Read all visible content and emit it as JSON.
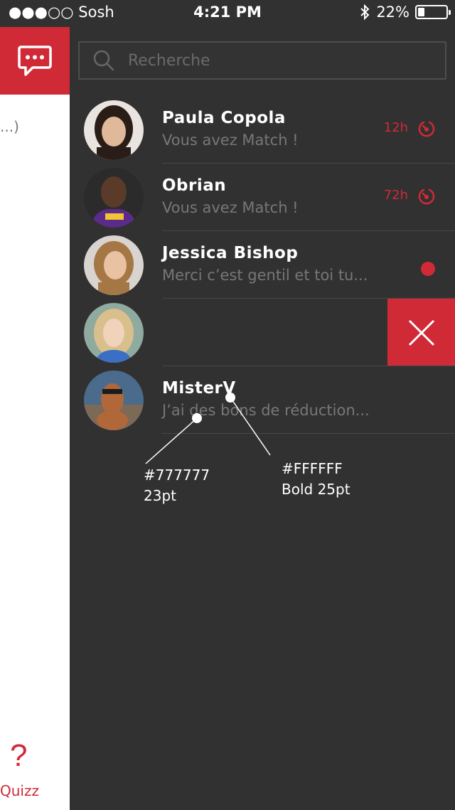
{
  "status_bar": {
    "carrier": "●●●○○ Sosh",
    "time": "4:21 PM",
    "battery": "22%"
  },
  "left_panel": {
    "snippet": "...)",
    "quizz_icon": "?",
    "quizz_label": "Quizz"
  },
  "search": {
    "placeholder": "Recherche",
    "value": ""
  },
  "conversations": [
    {
      "name": "Paula Copola",
      "message": "Vous avez Match !",
      "time": "12h",
      "status": "timer"
    },
    {
      "name": "Obrian",
      "message": "Vous avez Match !",
      "time": "72h",
      "status": "timer"
    },
    {
      "name": "Jessica Bishop",
      "message": "Merci c’est gentil et toi tu...",
      "time": "",
      "status": "unread"
    },
    {
      "name": "",
      "message": "",
      "time": "",
      "status": "delete"
    },
    {
      "name": "MisterV",
      "message": "J’ai des bons de réduction...",
      "time": "",
      "status": ""
    }
  ],
  "annotations": {
    "grey": "#777777\n23pt",
    "white": "#FFFFFF\nBold 25pt"
  },
  "colors": {
    "accent": "#cf2a36",
    "background": "#313131",
    "secondary_text": "#777777",
    "primary_text": "#FFFFFF"
  },
  "icons": {
    "chat_tab": "chat-bubble-icon",
    "search": "search-icon",
    "timer": "timer-icon",
    "delete": "close-icon"
  }
}
